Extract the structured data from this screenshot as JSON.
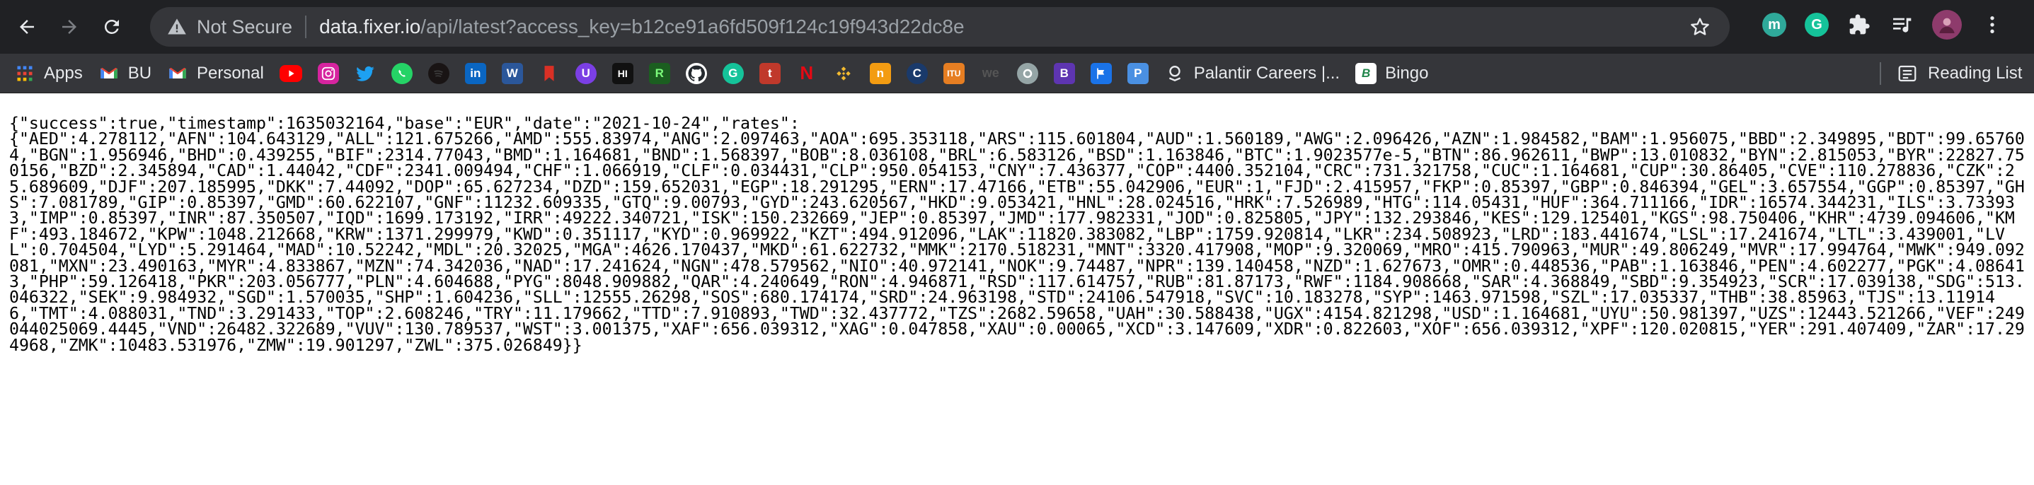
{
  "toolbar": {
    "security_label": "Not Secure",
    "url_host": "data.fixer.io",
    "url_path": "/api/latest?access_key=b12ce91a6fd509f124c19f943d22dc8e"
  },
  "extensions": [
    {
      "icon": "m-circle-icon",
      "letter": "m",
      "color": "#2fa99a"
    },
    {
      "icon": "grammarly-icon",
      "letter": "G",
      "color": "#15c39a"
    }
  ],
  "bookmarks": [
    {
      "label": "Apps",
      "icon": "apps-grid-icon",
      "color": "#4285f4"
    },
    {
      "label": "BU",
      "icon": "gmail-icon",
      "color": "#ea4335"
    },
    {
      "label": "Personal",
      "icon": "gmail-icon",
      "color": "#ea4335"
    },
    {
      "label": "",
      "icon": "youtube-icon",
      "color": "#ff0000"
    },
    {
      "label": "",
      "icon": "instagram-icon",
      "color": "#d6249f"
    },
    {
      "label": "",
      "icon": "twitter-icon",
      "color": "#1da1f2"
    },
    {
      "label": "",
      "icon": "whatsapp-icon",
      "color": "#25d366"
    },
    {
      "label": "",
      "icon": "spotify-icon",
      "color": "#191414"
    },
    {
      "label": "",
      "icon": "linkedin-icon",
      "color": "#0a66c2"
    },
    {
      "label": "",
      "icon": "word-icon",
      "color": "#2b579a"
    },
    {
      "label": "",
      "icon": "bookmark-red-icon",
      "color": "#d93025"
    },
    {
      "label": "",
      "icon": "u-circle-icon",
      "color": "#7b3fe4"
    },
    {
      "label": "",
      "icon": "hi-icon",
      "color": "#111111"
    },
    {
      "label": "",
      "icon": "green-r-icon",
      "color": "#34a853"
    },
    {
      "label": "",
      "icon": "github-icon",
      "color": "#24292e"
    },
    {
      "label": "",
      "icon": "grammarly-icon",
      "color": "#15c39a"
    },
    {
      "label": "",
      "icon": "tumblr-icon",
      "color": "#c0392b"
    },
    {
      "label": "",
      "icon": "netflix-icon",
      "color": "#e50914"
    },
    {
      "label": "",
      "icon": "binance-icon",
      "color": "#f3ba2f"
    },
    {
      "label": "",
      "icon": "orange-square-icon",
      "color": "#f39c12"
    },
    {
      "label": "",
      "icon": "c-circle-icon",
      "color": "#1a3a6b"
    },
    {
      "label": "",
      "icon": "itu-icon",
      "color": "#e67e22"
    },
    {
      "label": "",
      "icon": "we-icon",
      "color": "#222222"
    },
    {
      "label": "",
      "icon": "gear-circle-icon",
      "color": "#7f8c8d"
    },
    {
      "label": "",
      "icon": "b-square-icon",
      "color": "#5e35b1"
    },
    {
      "label": "",
      "icon": "flag-icon",
      "color": "#1a73e8"
    },
    {
      "label": "",
      "icon": "p-square-icon",
      "color": "#4a90e2"
    },
    {
      "label": "Palantir Careers |...",
      "icon": "palantir-icon",
      "color": "#e8eaed"
    },
    {
      "label": "Bingo",
      "icon": "bingo-icon",
      "color": "#1e8449"
    }
  ],
  "reading_list_label": "Reading List",
  "content": {
    "json_text": "{\"success\":true,\"timestamp\":1635032164,\"base\":\"EUR\",\"date\":\"2021-10-24\",\"rates\":\n{\"AED\":4.278112,\"AFN\":104.643129,\"ALL\":121.675266,\"AMD\":555.83974,\"ANG\":2.097463,\"AOA\":695.353118,\"ARS\":115.601804,\"AUD\":1.560189,\"AWG\":2.096426,\"AZN\":1.984582,\"BAM\":1.956075,\"BBD\":2.349895,\"BDT\":99.657604,\"BGN\":1.956946,\"BHD\":0.439255,\"BIF\":2314.77043,\"BMD\":1.164681,\"BND\":1.568397,\"BOB\":8.036108,\"BRL\":6.583126,\"BSD\":1.163846,\"BTC\":1.9023577e-5,\"BTN\":86.962611,\"BWP\":13.010832,\"BYN\":2.815053,\"BYR\":22827.750156,\"BZD\":2.345894,\"CAD\":1.44042,\"CDF\":2341.009494,\"CHF\":1.066919,\"CLF\":0.034431,\"CLP\":950.054153,\"CNY\":7.436377,\"COP\":4400.352104,\"CRC\":731.321758,\"CUC\":1.164681,\"CUP\":30.86405,\"CVE\":110.278836,\"CZK\":25.689609,\"DJF\":207.185995,\"DKK\":7.44092,\"DOP\":65.627234,\"DZD\":159.652031,\"EGP\":18.291295,\"ERN\":17.47166,\"ETB\":55.042906,\"EUR\":1,\"FJD\":2.415957,\"FKP\":0.85397,\"GBP\":0.846394,\"GEL\":3.657554,\"GGP\":0.85397,\"GHS\":7.081789,\"GIP\":0.85397,\"GMD\":60.622107,\"GNF\":11232.609335,\"GTQ\":9.00793,\"GYD\":243.620567,\"HKD\":9.053421,\"HNL\":28.024516,\"HRK\":7.526989,\"HTG\":114.05431,\"HUF\":364.711166,\"IDR\":16574.344231,\"ILS\":3.733933,\"IMP\":0.85397,\"INR\":87.350507,\"IQD\":1699.173192,\"IRR\":49222.340721,\"ISK\":150.232669,\"JEP\":0.85397,\"JMD\":177.982331,\"JOD\":0.825805,\"JPY\":132.293846,\"KES\":129.125401,\"KGS\":98.750406,\"KHR\":4739.094606,\"KMF\":493.184672,\"KPW\":1048.212668,\"KRW\":1371.299979,\"KWD\":0.351117,\"KYD\":0.969922,\"KZT\":494.912096,\"LAK\":11820.383082,\"LBP\":1759.920814,\"LKR\":234.508923,\"LRD\":183.441674,\"LSL\":17.241674,\"LTL\":3.439001,\"LVL\":0.704504,\"LYD\":5.291464,\"MAD\":10.52242,\"MDL\":20.32025,\"MGA\":4626.170437,\"MKD\":61.622732,\"MMK\":2170.518231,\"MNT\":3320.417908,\"MOP\":9.320069,\"MRO\":415.790963,\"MUR\":49.806249,\"MVR\":17.994764,\"MWK\":949.092081,\"MXN\":23.490163,\"MYR\":4.833867,\"MZN\":74.342036,\"NAD\":17.241624,\"NGN\":478.579562,\"NIO\":40.972141,\"NOK\":9.74487,\"NPR\":139.140458,\"NZD\":1.627673,\"OMR\":0.448536,\"PAB\":1.163846,\"PEN\":4.602277,\"PGK\":4.086413,\"PHP\":59.126418,\"PKR\":203.056777,\"PLN\":4.604688,\"PYG\":8048.909882,\"QAR\":4.240649,\"RON\":4.946871,\"RSD\":117.614757,\"RUB\":81.87173,\"RWF\":1184.908668,\"SAR\":4.368849,\"SBD\":9.354923,\"SCR\":17.039138,\"SDG\":513.046322,\"SEK\":9.984932,\"SGD\":1.570035,\"SHP\":1.604236,\"SLL\":12555.26298,\"SOS\":680.174174,\"SRD\":24.963198,\"STD\":24106.547918,\"SVC\":10.183278,\"SYP\":1463.971598,\"SZL\":17.035337,\"THB\":38.85963,\"TJS\":13.119146,\"TMT\":4.088031,\"TND\":3.291433,\"TOP\":2.608246,\"TRY\":11.179662,\"TTD\":7.910893,\"TWD\":32.437772,\"TZS\":2682.59658,\"UAH\":30.588438,\"UGX\":4154.821298,\"USD\":1.164681,\"UYU\":50.981397,\"UZS\":12443.521266,\"VEF\":249044025069.4445,\"VND\":26482.322689,\"VUV\":130.789537,\"WST\":3.001375,\"XAF\":656.039312,\"XAG\":0.047858,\"XAU\":0.00065,\"XCD\":3.147609,\"XDR\":0.822603,\"XOF\":656.039312,\"XPF\":120.020815,\"YER\":291.407409,\"ZAR\":17.294968,\"ZMK\":10483.531976,\"ZMW\":19.901297,\"ZWL\":375.026849}}"
  }
}
